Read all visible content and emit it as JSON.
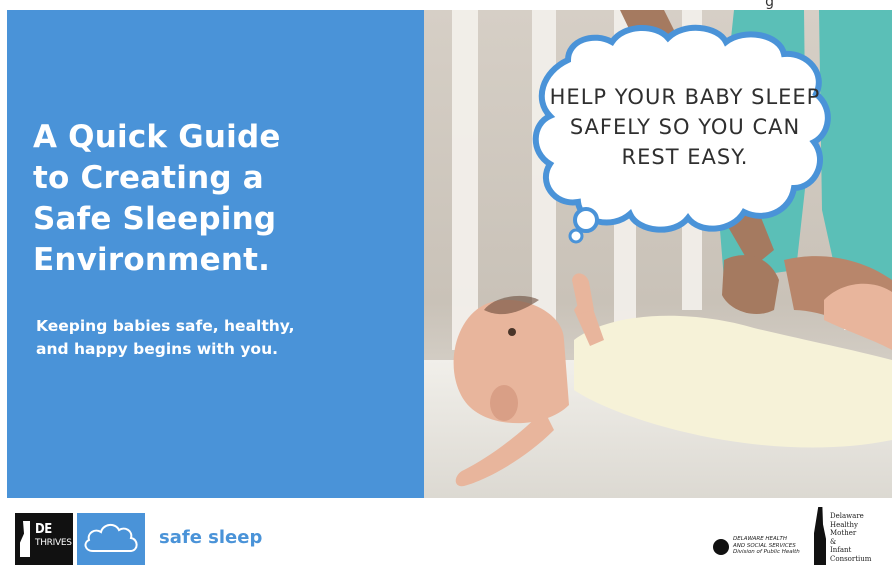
{
  "corner_text": "g",
  "headline": [
    "A Quick Guide",
    "to Creating a",
    "Safe Sleeping",
    "Environment."
  ],
  "subhead": [
    "Keeping babies safe, healthy,",
    "and happy begins with you."
  ],
  "speech_bubble": [
    "HELP YOUR BABY SLEEP",
    "SAFELY SO YOU CAN",
    "REST EASY."
  ],
  "footer": {
    "de_thrives": {
      "line1": "DE",
      "line2": "THRIVES"
    },
    "program_label": "safe sleep",
    "dhss": [
      "DELAWARE HEALTH",
      "AND SOCIAL SERVICES",
      "Division of Public Health"
    ],
    "dhmic": [
      "Delaware",
      "Healthy",
      "Mother",
      "&",
      "Infant",
      "Consortium"
    ]
  },
  "colors": {
    "brand_blue": "#4a93d8",
    "text_on_blue": "#ffffff",
    "bubble_outline": "#4a93d8"
  }
}
